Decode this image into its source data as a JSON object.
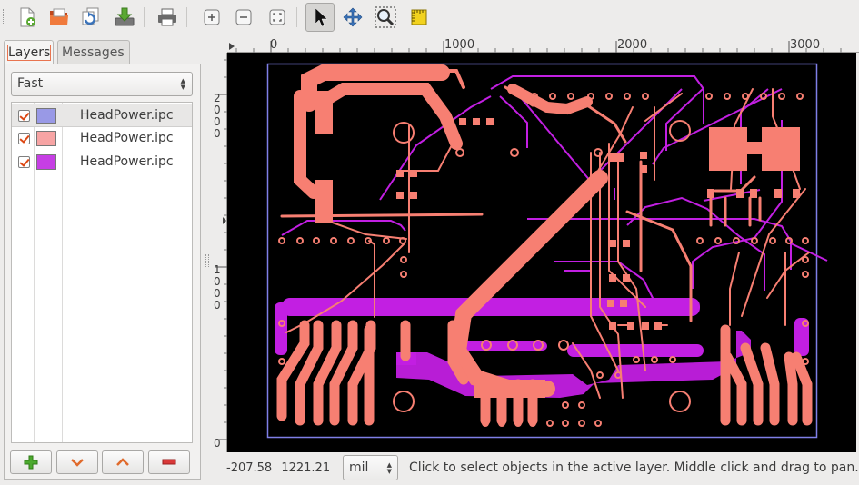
{
  "toolbar": {
    "buttons": [
      {
        "name": "new-icon"
      },
      {
        "name": "open-icon"
      },
      {
        "name": "reload-icon"
      },
      {
        "name": "import-icon"
      },
      {
        "name": "print-icon"
      },
      {
        "name": "zoom-in-icon"
      },
      {
        "name": "zoom-out-icon"
      },
      {
        "name": "zoom-fit-icon"
      },
      {
        "name": "pointer-icon",
        "active": true
      },
      {
        "name": "move-icon"
      },
      {
        "name": "zoom-region-icon"
      },
      {
        "name": "measure-icon"
      }
    ]
  },
  "sidebar": {
    "tabs": [
      {
        "label": "Layers",
        "selected": true
      },
      {
        "label": "Messages",
        "selected": false
      }
    ],
    "render_mode": "Fast",
    "layers": [
      {
        "name": "HeadPower.ipc",
        "visible": true,
        "color": "#9999e6",
        "selected": true
      },
      {
        "name": "HeadPower.ipc",
        "visible": true,
        "color": "#f7a4a4",
        "selected": false
      },
      {
        "name": "HeadPower.ipc",
        "visible": true,
        "color": "#c63fe4",
        "selected": false
      }
    ],
    "buttons": [
      {
        "name": "add-layer-button",
        "icon": "plus-icon",
        "color": "#4caa2f"
      },
      {
        "name": "move-down-button",
        "icon": "chevron-down-icon",
        "color": "#e06a2c"
      },
      {
        "name": "move-up-button",
        "icon": "chevron-up-icon",
        "color": "#e06a2c"
      },
      {
        "name": "remove-layer-button",
        "icon": "minus-icon",
        "color": "#d93838"
      }
    ]
  },
  "ruler": {
    "h_ticks": [
      "0",
      "1000",
      "2000",
      "3000"
    ],
    "v_ticks": [
      "2000",
      "1000",
      "0"
    ]
  },
  "colors": {
    "board_outline": "#7f7fe6",
    "copper_top": "#f77f72",
    "copper_bottom": "#c21fe2",
    "background": "#000000"
  },
  "status": {
    "x": "-207.58",
    "y": "1221.21",
    "units": "mil",
    "hint": "Click to select objects in the active layer. Middle click and drag to pan."
  }
}
